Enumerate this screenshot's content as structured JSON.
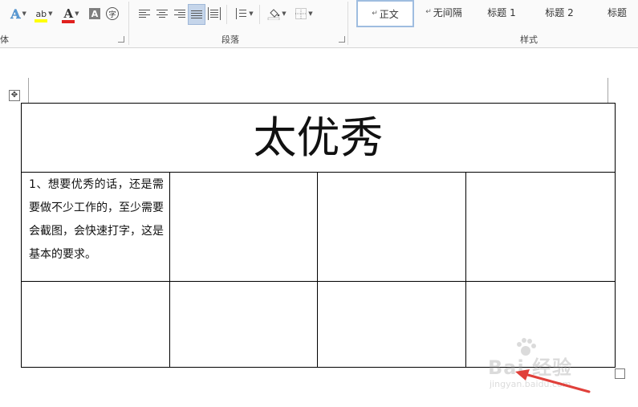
{
  "ribbon": {
    "groups": {
      "font_label": "体",
      "paragraph_label": "段落",
      "styles_label": "样式"
    },
    "font_icons": {
      "text_effect": "A",
      "highlight": "ab",
      "font_color": "A",
      "char_shading": "A",
      "enclose_char": "字"
    },
    "styles": [
      {
        "label": "正文",
        "selected": true
      },
      {
        "label": "无间隔",
        "selected": false
      },
      {
        "label": "标题 1",
        "selected": false
      },
      {
        "label": "标题 2",
        "selected": false
      },
      {
        "label": "标题",
        "selected": false
      }
    ],
    "colors": {
      "highlight": "#ffff00",
      "font_color": "#e0201e",
      "accent_selected": "#c5d5ea"
    }
  },
  "document": {
    "table": {
      "title": "太优秀",
      "rows": [
        [
          "1、想要优秀的话，还是需要做不少工作的，至少需要会截图，会快速打字，这是基本的要求。",
          "",
          "",
          ""
        ],
        [
          "",
          "",
          "",
          ""
        ]
      ]
    }
  },
  "watermark": {
    "brand": "Bai 经验",
    "url": "jingyan.baidu.com"
  },
  "annotation": {
    "arrow_color": "#e0403a"
  }
}
